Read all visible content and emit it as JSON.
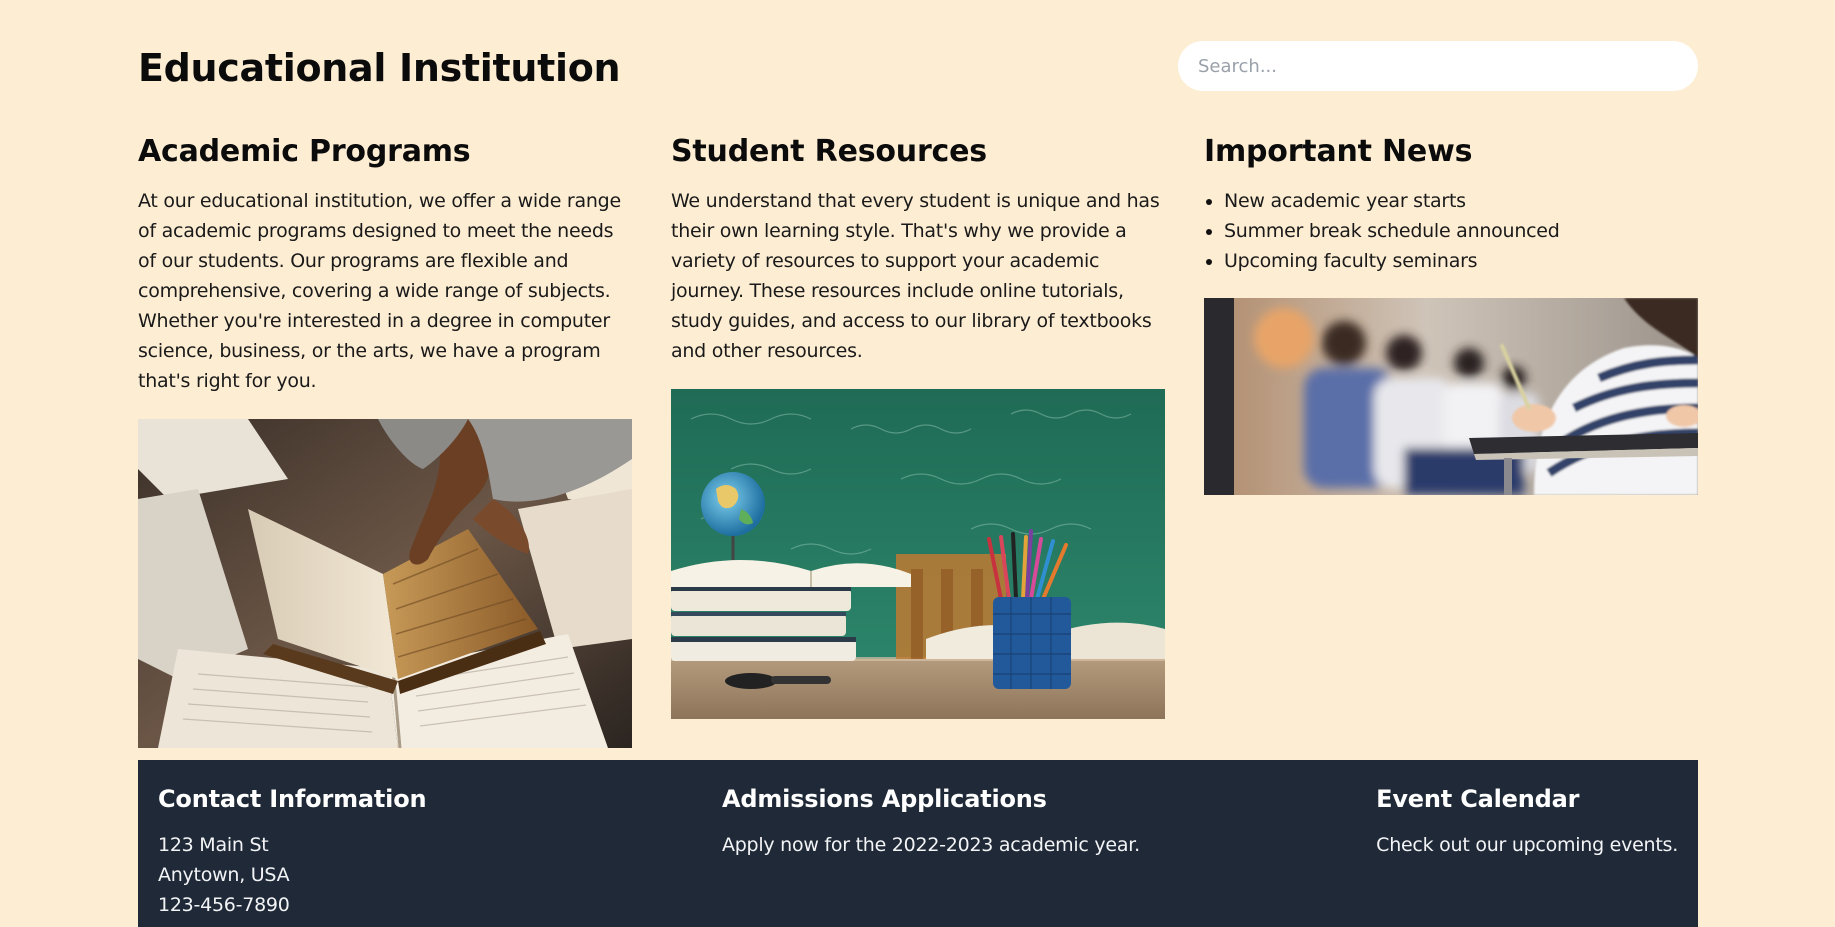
{
  "header": {
    "title": "Educational Institution",
    "search_placeholder": "Search..."
  },
  "columns": [
    {
      "title": "Academic Programs",
      "text": "At our educational institution, we offer a wide range of academic programs designed to meet the needs of our students. Our programs are flexible and comprehensive, covering a wide range of subjects. Whether you're interested in a degree in computer science, business, or the arts, we have a program that's right for you."
    },
    {
      "title": "Student Resources",
      "text": "We understand that every student is unique and has their own learning style. That's why we provide a variety of resources to support your academic journey. These resources include online tutorials, study guides, and access to our library of textbooks and other resources."
    },
    {
      "title": "Important News",
      "items": [
        "New academic year starts",
        "Summer break schedule announced",
        "Upcoming faculty seminars"
      ]
    }
  ],
  "footer": {
    "contact": {
      "title": "Contact Information",
      "lines": [
        "123 Main St",
        "Anytown, USA",
        "123-456-7890"
      ]
    },
    "admissions": {
      "title": "Admissions Applications",
      "text": "Apply now for the 2022-2023 academic year."
    },
    "events": {
      "title": "Event Calendar",
      "text": "Check out our upcoming events."
    }
  },
  "colors": {
    "page_background": "#fdedd3",
    "footer_background": "#1f2937",
    "search_background": "#ffffff"
  }
}
